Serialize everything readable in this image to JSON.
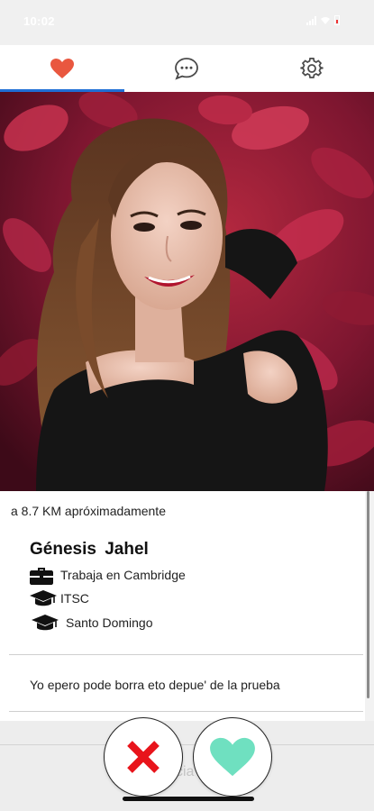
{
  "status_bar": {
    "time": "10:02",
    "battery_color": "#e33333"
  },
  "tabs": [
    {
      "name": "likes",
      "icon": "heart-icon",
      "active": true,
      "color": "#e9573f"
    },
    {
      "name": "chat",
      "icon": "chat-bubble-icon",
      "active": false
    },
    {
      "name": "settings",
      "icon": "gear-icon",
      "active": false
    }
  ],
  "profile": {
    "distance": "a 8.7 KM apróximadamente",
    "name": "Génesis  Jahel",
    "work": "Trabaja en Cambridge",
    "school": "ITSC",
    "city": "Santo Domingo",
    "bio": "Yo epero pode borra eto depue' de la prueba"
  },
  "actions": {
    "reject_icon": "x-icon",
    "like_icon": "heart-icon",
    "reject_color": "#e8141b",
    "like_color": "#6fe0c0"
  },
  "bottom": {
    "ghost_text": "cia"
  }
}
